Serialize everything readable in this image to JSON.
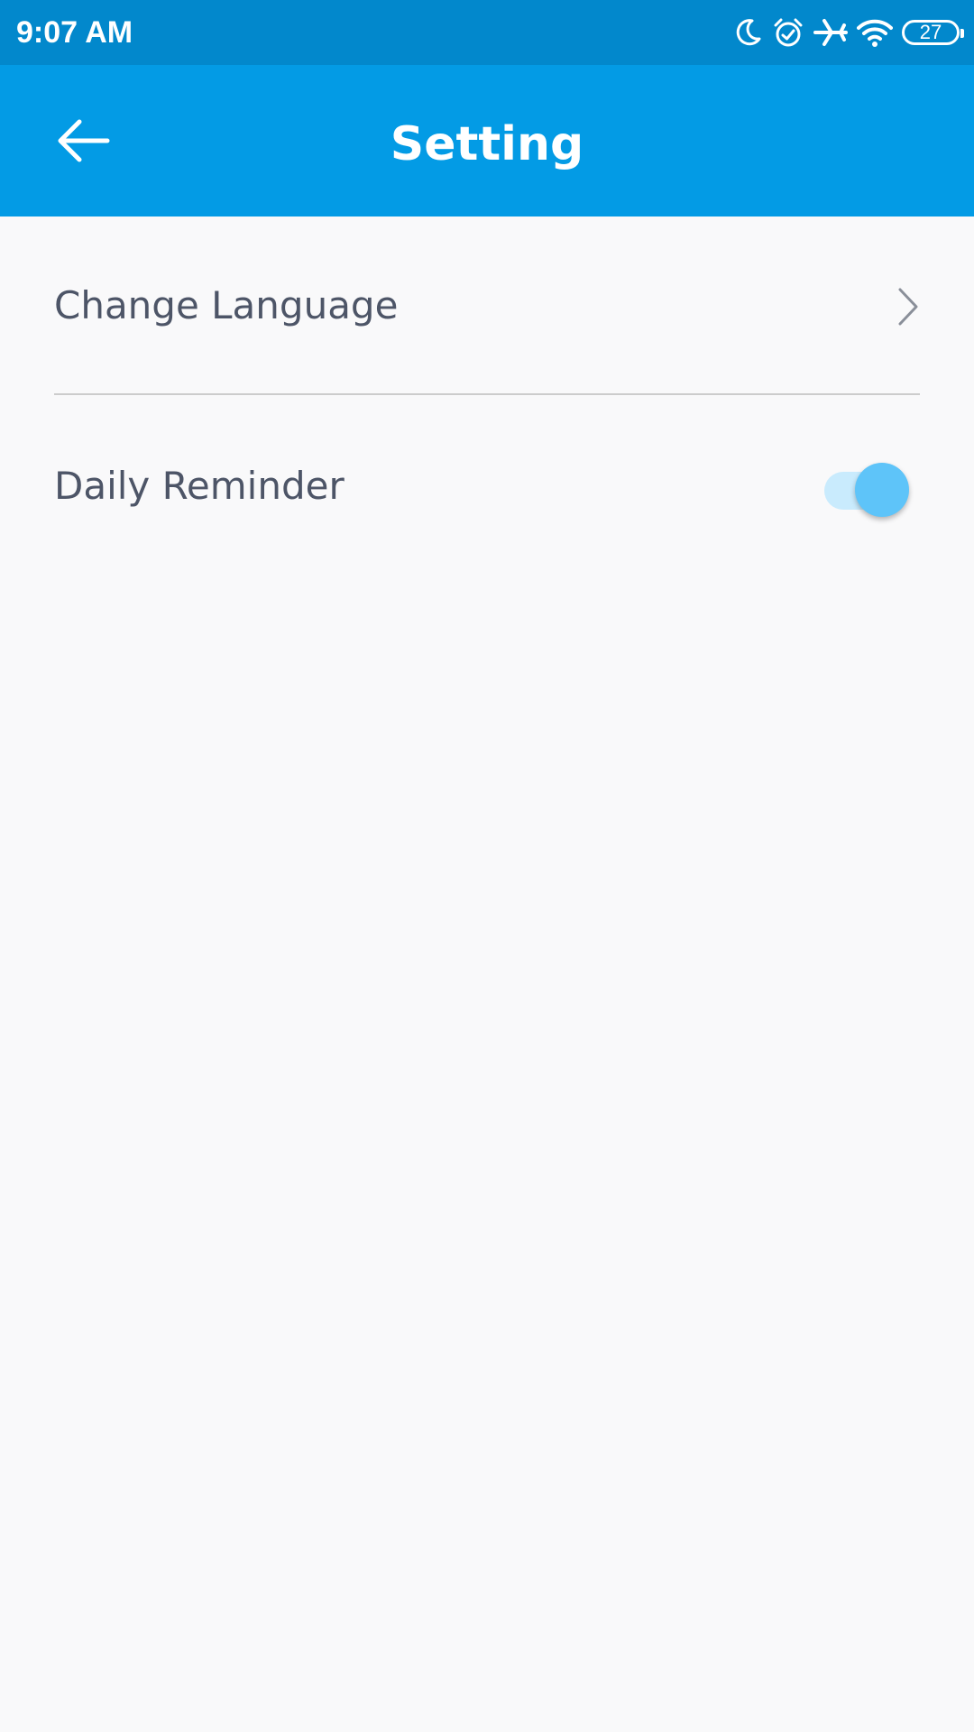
{
  "status_bar": {
    "time": "9:07 AM",
    "battery": "27",
    "icons": [
      "moon-icon",
      "alarm-icon",
      "airplane-icon",
      "wifi-icon",
      "battery-icon"
    ]
  },
  "header": {
    "title": "Setting",
    "back_icon": "arrow-left-icon",
    "background": "#039be5"
  },
  "settings": {
    "items": [
      {
        "label": "Change Language",
        "control": "chevron-right-icon"
      },
      {
        "label": "Daily Reminder",
        "control": "toggle",
        "enabled": true
      }
    ]
  },
  "colors": {
    "status_bar": "#0288cc",
    "app_bar": "#039be5",
    "text": "#4d5567",
    "toggle_thumb": "#5ec4f9",
    "toggle_track": "#c9ebfd",
    "background": "#f9f9fa"
  }
}
